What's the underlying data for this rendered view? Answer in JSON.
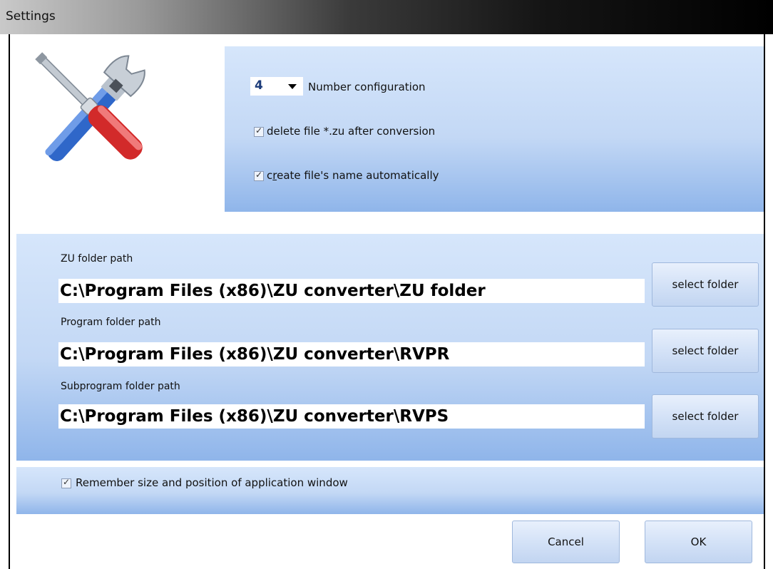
{
  "window": {
    "title": "Settings"
  },
  "icons": {
    "tools": "screwdriver-wrench-icon",
    "dropdown": "chevron-down-icon",
    "check": "checkmark-icon"
  },
  "options": {
    "number_value": "4",
    "number_label": "Number configuration",
    "delete_file_label": "delete file *.zu after conversion",
    "delete_file_checked": true,
    "create_name_prefix": "c",
    "create_name_mnemonic": "r",
    "create_name_suffix": "eate file's name automatically",
    "create_name_checked": true
  },
  "folders": {
    "zu_label": "ZU folder path",
    "zu_value": "C:\\Program Files (x86)\\ZU converter\\ZU folder",
    "program_label": "Program folder path",
    "program_value": "C:\\Program Files (x86)\\ZU converter\\RVPR",
    "subprogram_label": "Subprogram folder path",
    "subprogram_value": "C:\\Program Files (x86)\\ZU converter\\RVPS",
    "select_label": "select folder"
  },
  "window_option": {
    "label": "Remember size and position of application window",
    "checked": true
  },
  "buttons": {
    "cancel": "Cancel",
    "ok": "OK"
  },
  "colors": {
    "panel_top": "#d6e6fb",
    "panel_bottom": "#8fb5ea",
    "button": "#d4e2f7"
  }
}
